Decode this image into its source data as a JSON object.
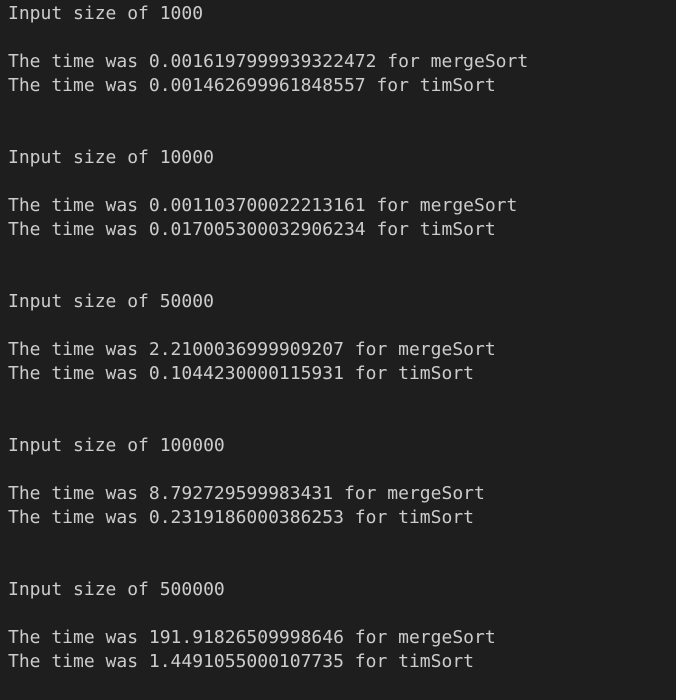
{
  "terminal": {
    "lines": [
      "Input size of 1000",
      "The time was 0.0016197999939322472 for mergeSort",
      "The time was 0.001462699961848557 for timSort",
      "Input size of 10000",
      "The time was 0.001103700022213161 for mergeSort",
      "The time was 0.017005300032906234 for timSort",
      "Input size of 50000",
      "The time was 2.2100036999909207 for mergeSort",
      "The time was 0.1044230000115931 for timSort",
      "Input size of 100000",
      "The time was 8.792729599983431 for mergeSort",
      "The time was 0.2319186000386253 for timSort",
      "Input size of 500000",
      "The time was 191.91826509998646 for mergeSort",
      "The time was 1.4491055000107735 for timSort"
    ]
  },
  "colors": {
    "background": "#1e1e1e",
    "text": "#cccccc"
  }
}
